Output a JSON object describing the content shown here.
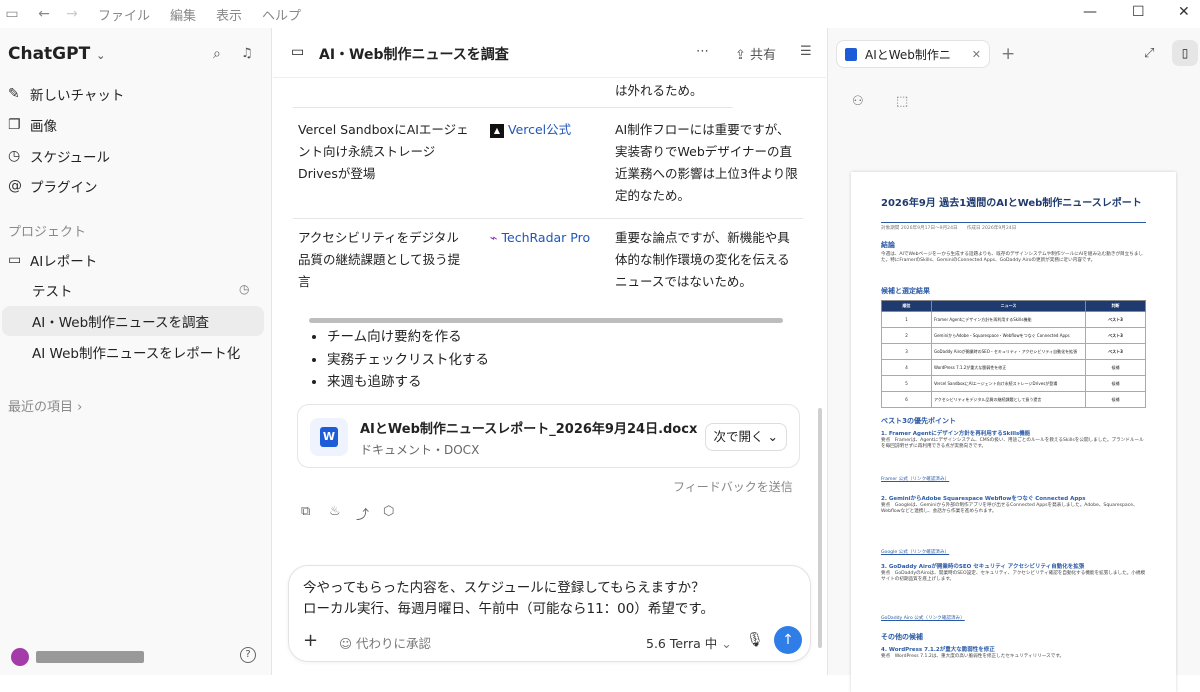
{
  "menu": [
    "ファイル",
    "編集",
    "表示",
    "ヘルプ"
  ],
  "sidebar": {
    "brand": "ChatGPT",
    "items": [
      {
        "label": "新しいチャット",
        "icon": "edit-icon"
      },
      {
        "label": "画像",
        "icon": "image-icon"
      },
      {
        "label": "スケジュール",
        "icon": "clock-icon"
      },
      {
        "label": "プラグイン",
        "icon": "at-icon"
      }
    ],
    "projects_label": "プロジェクト",
    "project": "AIレポート",
    "subitems": [
      "テスト",
      "AI・Web制作ニュースを調査",
      "AI Web制作ニュースをレポート化"
    ],
    "recent_label": "最近の項目"
  },
  "chat": {
    "title": "AI・Web制作ニュースを調査",
    "share": "共有",
    "top_fragment": "は外れるため。",
    "rows": [
      {
        "news": "Vercel SandboxにAIエージェント向け永続ストレージDrivesが登場",
        "source": "Vercel公式",
        "reason": "AI制作フローには重要ですが、実装寄りでWebデザイナーの直近業務への影響は上位3件より限定的なため。"
      },
      {
        "news": "アクセシビリティをデジタル品質の継続課題として扱う提言",
        "source": "TechRadar Pro",
        "reason": "重要な論点ですが、新機能や具体的な制作環境の変化を伝えるニュースではないため。"
      }
    ],
    "bullets": [
      "チーム向け要約を作る",
      "実務チェックリスト化する",
      "来週も追跡する"
    ],
    "file": {
      "name": "AIとWeb制作ニュースレポート_2026年9月24日.docx",
      "type": "ドキュメント・DOCX",
      "open": "次で開く"
    },
    "feedback": "フィードバックを送信",
    "composer": {
      "line1": "今やってもらった内容を、スケジュールに登録してもらえますか？",
      "line2": "ローカル実行、毎週月曜日、午前中（可能なら11：00）希望です。",
      "approve": "代わりに承認",
      "model": "5.6 Terra 中"
    }
  },
  "panel": {
    "tab": "AIとWeb制作ニ",
    "doc": {
      "title": "2026年9月 過去1週間のAIとWeb制作ニュースレポート",
      "meta": "対象期間 2026年9月17日〜9月24日　　作成日 2026年9月24日",
      "h_summary": "結論",
      "summary": "今週は、AIでWebページを一から生成する話題よりも、既存のデザインシステムや制作ツールにAIを組み込む動きが目立ちました。特にFramerのSkills、GeminiのConnected Apps、GoDaddy Airoの更新が実務に近い内容です。",
      "h_table": "候補と選定結果",
      "table_head": [
        "順位",
        "ニュース",
        "判断"
      ],
      "table_rows": [
        [
          "1",
          "Framer Agentにデザイン方針を再利用するSkills機能",
          "ベスト3"
        ],
        [
          "2",
          "GeminiからAdobe・Squarespace・Webflowをつなぐ Connected Apps",
          "ベスト3"
        ],
        [
          "3",
          "GoDaddy Airoが開業時のSEO・セキュリティ・アクセシビリティ自動化を拡張",
          "ベスト3"
        ],
        [
          "4",
          "WordPress 7.1.2が重大な脆弱性を修正",
          "候補"
        ],
        [
          "5",
          "Vercel SandboxにAIエージェント向け永続ストレージDrivesが登場",
          "候補"
        ],
        [
          "6",
          "アクセシビリティをデジタル品質の継続課題として扱う提言",
          "候補"
        ]
      ],
      "h_best": "ベスト3の優先ポイント",
      "best": [
        {
          "title": "1. Framer Agentにデザイン方針を再利用するSkills機能",
          "body": "要点　Framerは、Agentにデザインシステム、CMSの扱い、用途ごとのルールを教えるSkillsを公開しました。ブランドルールを毎回説明せずに再利用できる点が実務向きです。",
          "link": "Framer 公式（リンク確認済み）"
        },
        {
          "title": "2. GeminiからAdobe Squarespace Webflowをつなぐ Connected Apps",
          "body": "要点　Googleは、Geminiから外部の制作アプリを呼び出せるConnected Appsを発表しました。Adobe、Squarespace、Webflowなどと連携し、会話から作業を進められます。",
          "link": "Google 公式（リンク確認済み）"
        },
        {
          "title": "3. GoDaddy Airoが開業時のSEO セキュリティ アクセシビリティ自動化を拡張",
          "body": "要点　GoDaddyのAiroは、開業時のSEO設定、セキュリティ、アクセシビリティ確認を自動化する機能を拡張しました。小規模サイトの初期品質を底上げします。",
          "link": "GoDaddy Airo 公式（リンク確認済み）"
        }
      ],
      "h_other": "その他の候補",
      "other_title": "4. WordPress 7.1.2が重大な脆弱性を修正",
      "other_body": "要点　WordPress 7.1.2は、重大度の高い脆弱性を修正したセキュリティリリースです。"
    }
  },
  "colors": {
    "accent": "#2f7ee8",
    "doc_heading": "#1f3a6e",
    "avatar": "#a33ca8"
  }
}
